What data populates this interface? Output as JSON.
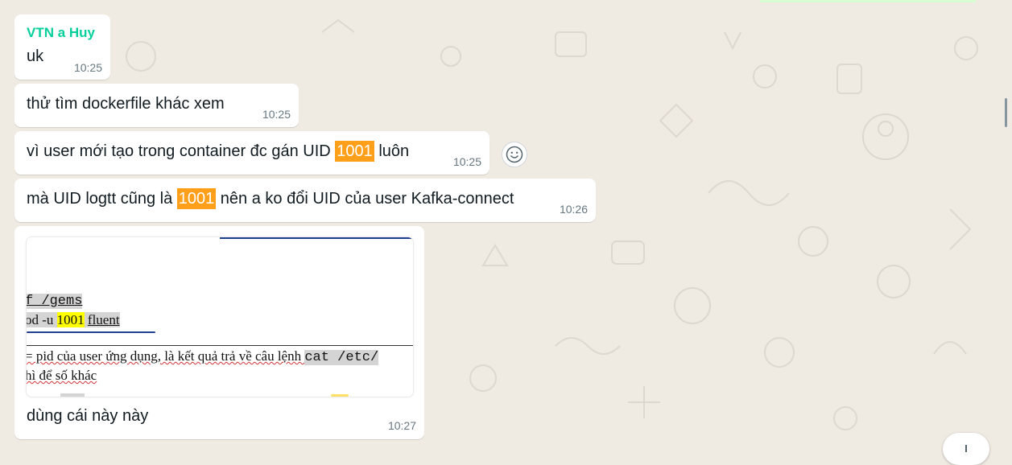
{
  "colors": {
    "background": "#efeae2",
    "bubble": "#ffffff",
    "sender": "#06cf9c",
    "search_highlight": "#ff9f1a",
    "timestamp": "#667781"
  },
  "messages": [
    {
      "sender": "VTN a Huy",
      "text": "uk",
      "time": "10:25"
    },
    {
      "text": "thử tìm dockerfile khác xem",
      "time": "10:25"
    },
    {
      "text_before": "vì user mới tạo trong container đc gán UID ",
      "highlight": "1001",
      "text_after": " luôn",
      "time": "10:25"
    },
    {
      "text_before": "mà UID logtt cũng là ",
      "highlight": "1001",
      "text_after": " nên a ko đổi UID của user Kafka-connect",
      "time": "10:26"
    },
    {
      "image": {
        "line1": "f /gems",
        "line2_prefix": "od -u ",
        "line2_uid": "1001",
        "line2_user": "fluent",
        "line3_text": "= pid của user ứng dụng, là kết quả trả về câu lệnh ",
        "line3_cmd": "cat /etc/",
        "line4": "hì để số khác"
      },
      "caption": "dùng cái này này",
      "time": "10:27"
    }
  ],
  "icons": {
    "react": "smiley-icon",
    "scroll_down": "chevron-down-icon"
  }
}
